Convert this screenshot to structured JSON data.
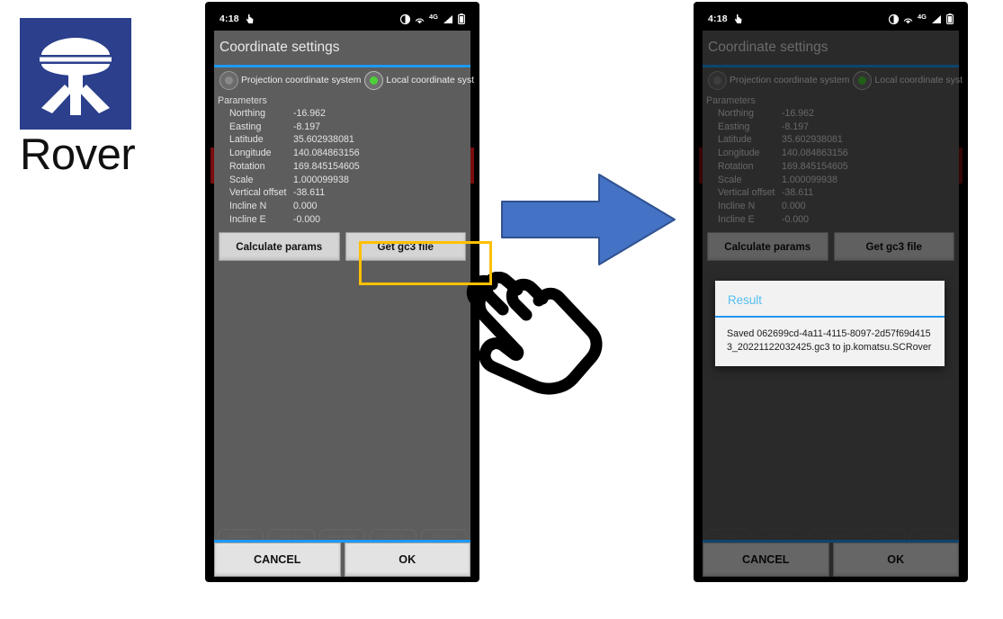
{
  "logo": {
    "caption": "Rover",
    "square_color": "#2B3F8C",
    "icon": "gnss-rover-antenna-icon"
  },
  "arrow": {
    "name": "right-arrow",
    "color": "#4472C4",
    "direction": "right"
  },
  "cursor": {
    "name": "pointing-hand-cursor"
  },
  "highlight": {
    "name": "get-gc3-file-highlight",
    "color": "#FFC000"
  },
  "phones": [
    {
      "id": "left",
      "statusbar": {
        "time": "4:18",
        "left_icons": [
          "touch-indicator-icon"
        ],
        "right_icons": [
          "brightness-icon",
          "cast-icon",
          "4g-icon",
          "signal-icon",
          "battery-icon"
        ],
        "network_label": "4G"
      },
      "app": {
        "title": "Coordinate settings",
        "radios": [
          {
            "label": "Projection coordinate system",
            "selected": false
          },
          {
            "label": "Local coordinate system",
            "selected": true
          }
        ],
        "parameters_label": "Parameters",
        "parameters": [
          {
            "name": "Northing",
            "value": "-16.962"
          },
          {
            "name": "Easting",
            "value": "-8.197"
          },
          {
            "name": "Latitude",
            "value": "35.602938081"
          },
          {
            "name": "Longitude",
            "value": "140.084863156"
          },
          {
            "name": "Rotation",
            "value": "169.845154605"
          },
          {
            "name": "Scale",
            "value": "1.000099938"
          },
          {
            "name": "Vertical offset",
            "value": "-38.611"
          },
          {
            "name": "Incline N",
            "value": "0.000"
          },
          {
            "name": "Incline E",
            "value": "-0.000"
          }
        ],
        "action_buttons": [
          {
            "label": "Calculate params"
          },
          {
            "label": "Get gc3 file"
          }
        ],
        "ghost_chips": [
          "Compass",
          "Auto line",
          "Auto scroll",
          "Zoom in",
          "Zoom out"
        ],
        "footer_buttons": [
          {
            "label": "CANCEL"
          },
          {
            "label": "OK"
          }
        ]
      },
      "navbar": [
        "back-icon",
        "home-icon",
        "recents-icon"
      ],
      "dialog": null
    },
    {
      "id": "right",
      "statusbar": {
        "time": "4:18",
        "left_icons": [
          "touch-indicator-icon"
        ],
        "right_icons": [
          "brightness-icon",
          "cast-icon",
          "4g-icon",
          "signal-icon",
          "battery-icon"
        ],
        "network_label": "4G"
      },
      "app": {
        "title": "Coordinate settings",
        "radios": [
          {
            "label": "Projection coordinate system",
            "selected": false
          },
          {
            "label": "Local coordinate system",
            "selected": true
          }
        ],
        "parameters_label": "Parameters",
        "parameters": [
          {
            "name": "Northing",
            "value": "-16.962"
          },
          {
            "name": "Easting",
            "value": "-8.197"
          },
          {
            "name": "Latitude",
            "value": "35.602938081"
          },
          {
            "name": "Longitude",
            "value": "140.084863156"
          },
          {
            "name": "Rotation",
            "value": "169.845154605"
          },
          {
            "name": "Scale",
            "value": "1.000099938"
          },
          {
            "name": "Vertical offset",
            "value": "-38.611"
          },
          {
            "name": "Incline N",
            "value": "0.000"
          },
          {
            "name": "Incline E",
            "value": "-0.000"
          }
        ],
        "action_buttons": [
          {
            "label": "Calculate params"
          },
          {
            "label": "Get gc3 file"
          }
        ],
        "ghost_chips": [
          "Compass",
          "Auto line",
          "Auto scroll",
          "Zoom in",
          "Zoom out"
        ],
        "footer_buttons": [
          {
            "label": "CANCEL"
          },
          {
            "label": "OK"
          }
        ]
      },
      "navbar": [
        "back-icon",
        "home-icon",
        "recents-icon"
      ],
      "dialog": {
        "title": "Result",
        "message": "Saved 062699cd-4a11-4115-8097-2d57f69d4153_20221122032425.gc3 to jp.komatsu.SCRover",
        "title_color": "#55bff0",
        "divider_color": "#2196f3"
      }
    }
  ]
}
